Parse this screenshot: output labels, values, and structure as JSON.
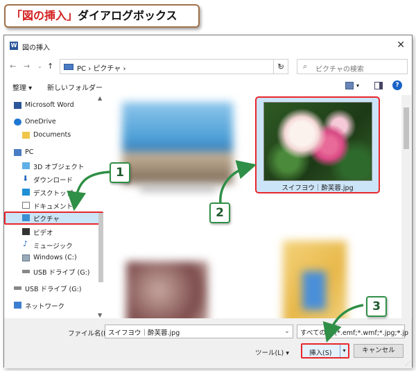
{
  "banner": {
    "title_red": "「図の挿入」",
    "title_black": "ダイアログボックス"
  },
  "window": {
    "title": "図の挿入",
    "app_icon": "W"
  },
  "address": {
    "path": "PC  ›  ピクチャ  ›",
    "search_placeholder": "ピクチャの検索"
  },
  "toolbar": {
    "organize": "整理 ▾",
    "new_folder": "新しいフォルダー"
  },
  "sidebar": {
    "items": [
      {
        "label": "Microsoft Word"
      },
      {
        "label": "OneDrive"
      },
      {
        "label": "Documents"
      },
      {
        "label": "PC"
      },
      {
        "label": "3D オブジェクト"
      },
      {
        "label": "ダウンロード"
      },
      {
        "label": "デスクトップ"
      },
      {
        "label": "ドキュメント"
      },
      {
        "label": "ピクチャ"
      },
      {
        "label": "ビデオ"
      },
      {
        "label": "ミュージック"
      },
      {
        "label": "Windows (C:)"
      },
      {
        "label": "USB ドライブ (G:)"
      },
      {
        "label": "USB ドライブ (G:)"
      },
      {
        "label": "ネットワーク"
      }
    ]
  },
  "content": {
    "selected_caption": "スイフヨウ｜酔芙蓉.jpg"
  },
  "footer": {
    "filename_label": "ファイル名(N):",
    "filename_value": "スイフヨウ｜酔芙蓉.jpg",
    "filetype_value": "すべての図 (*.emf;*.wmf;*.jpg;*.jp",
    "tools": "ツール(L)  ▾",
    "insert": "挿入(S)",
    "cancel": "キャンセル"
  },
  "callouts": {
    "one": "1",
    "two": "2",
    "three": "3"
  },
  "colors": {
    "highlight": "#e8262b",
    "selection": "#cce4f7",
    "callout": "#2f8f46"
  }
}
